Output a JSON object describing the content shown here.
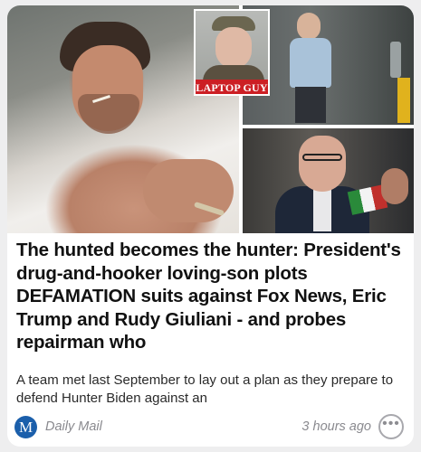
{
  "article": {
    "image": {
      "inset_label": "LAPTOP GUY"
    },
    "headline": "The hunted becomes the hunter: President's drug-and-hooker loving-son plots DEFAMATION suits against Fox News, Eric Trump and Rudy Giuliani - and probes repairman who",
    "summary": "A team met last September to lay out a plan as they prepare to defend Hunter Biden against an",
    "source": {
      "logo_letter": "M",
      "name": "Daily Mail",
      "logo_color": "#1b5fab"
    },
    "timestamp": "3 hours ago",
    "more_icon": "ellipsis-icon",
    "more_glyph": "•••"
  }
}
